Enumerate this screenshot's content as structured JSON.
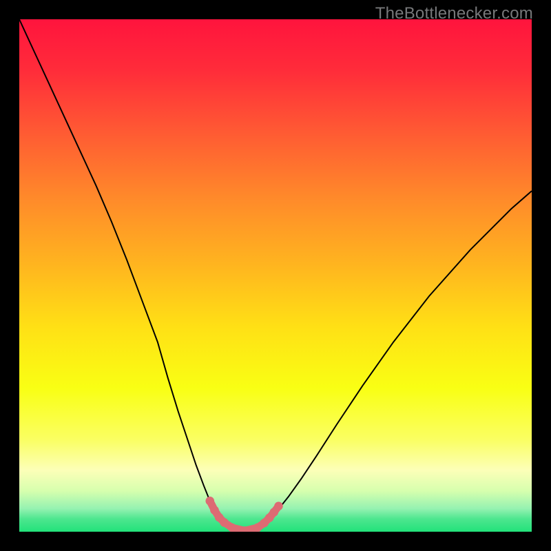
{
  "watermark": "TheBottlenecker.com",
  "chart_data": {
    "type": "line",
    "title": "",
    "xlabel": "",
    "ylabel": "",
    "xlim": [
      0,
      100
    ],
    "ylim": [
      0,
      100
    ],
    "background": {
      "type": "vertical-gradient",
      "stops": [
        {
          "offset": 0.0,
          "color": "#ff143d"
        },
        {
          "offset": 0.1,
          "color": "#ff2c3a"
        },
        {
          "offset": 0.22,
          "color": "#ff5a33"
        },
        {
          "offset": 0.35,
          "color": "#ff8a2a"
        },
        {
          "offset": 0.48,
          "color": "#ffb51f"
        },
        {
          "offset": 0.6,
          "color": "#ffe015"
        },
        {
          "offset": 0.72,
          "color": "#f9ff14"
        },
        {
          "offset": 0.82,
          "color": "#faff62"
        },
        {
          "offset": 0.88,
          "color": "#fcffb8"
        },
        {
          "offset": 0.92,
          "color": "#d7ffae"
        },
        {
          "offset": 0.955,
          "color": "#95f2b1"
        },
        {
          "offset": 0.975,
          "color": "#4de68f"
        },
        {
          "offset": 1.0,
          "color": "#22e27a"
        }
      ]
    },
    "series": [
      {
        "name": "bottleneck-curve",
        "color": "#000000",
        "stroke_width": 2,
        "x": [
          0,
          3,
          6,
          9,
          12,
          15,
          18,
          21,
          24,
          27,
          29,
          31,
          33,
          34.5,
          36,
          37.2,
          38.3,
          39.2,
          40.2,
          41.5,
          44.0,
          46.5,
          47.8,
          49.0,
          50.5,
          52.5,
          55,
          58,
          62,
          67,
          73,
          80,
          88,
          96,
          100
        ],
        "y": [
          100,
          93.5,
          87,
          80.5,
          74,
          67.5,
          60.5,
          53,
          45,
          37,
          30,
          23.5,
          17.5,
          13,
          9,
          6,
          4,
          2.6,
          1.6,
          0.8,
          0.2,
          0.8,
          1.6,
          2.7,
          4.3,
          6.8,
          10.3,
          14.8,
          21,
          28.5,
          37,
          46,
          55,
          63,
          66.5
        ]
      }
    ],
    "highlight": {
      "name": "optimal-zone",
      "color": "#dd6b73",
      "stroke_width": 11,
      "dots_radius": 6.3,
      "x": [
        37.2,
        38.1,
        39.0,
        40.0,
        41.5,
        44.0,
        46.5,
        47.8,
        48.8,
        49.7,
        50.6
      ],
      "y": [
        6.0,
        4.2,
        2.8,
        1.8,
        0.8,
        0.2,
        0.8,
        1.7,
        2.7,
        3.8,
        5.0
      ]
    }
  }
}
